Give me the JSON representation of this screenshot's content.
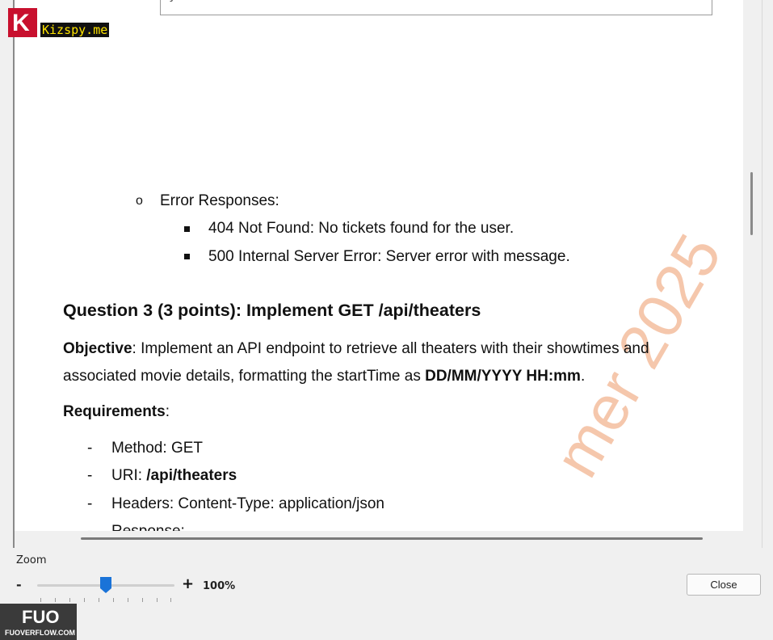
{
  "branding": {
    "logo_letter": "K",
    "site": "Kizspy.me",
    "footer_logo": "FUO",
    "footer_site": "FUOVERFLOW.COM"
  },
  "document": {
    "code_tail": "}",
    "error_responses_label": "Error Responses:",
    "error_items": [
      "404 Not Found: No tickets found for the user.",
      "500 Internal Server Error: Server error with message."
    ],
    "question_heading": "Question 3 (3 points): Implement GET /api/theaters",
    "objective_label": "Objective",
    "objective_text_1": ": Implement an API endpoint to retrieve all theaters with their showtimes and",
    "objective_text_2": "associated movie details, formatting the startTime as ",
    "objective_format": "DD/MM/YYYY HH:mm",
    "objective_period": ".",
    "requirements_label": "Requirements",
    "requirements_colon": ":",
    "requirements": {
      "method_label": "Method: ",
      "method_value": "GET",
      "uri_label": "URI: ",
      "uri_value": "/api/theaters",
      "headers_label": "Headers: ",
      "headers_value": "Content-Type: application/json",
      "response_partial": "Response:"
    },
    "watermark": "mer 2025"
  },
  "zoom": {
    "label": "Zoom",
    "minus": "-",
    "plus": "+",
    "value": "100%"
  },
  "close_button": "Close"
}
